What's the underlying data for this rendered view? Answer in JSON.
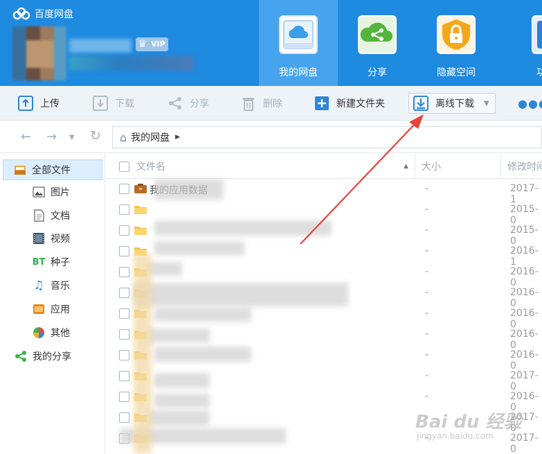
{
  "app": {
    "title": "百度网盘"
  },
  "user": {
    "badge": "VIP"
  },
  "nav_tabs": [
    {
      "label": "我的网盘",
      "icon": "cloud-drive-icon",
      "active": true
    },
    {
      "label": "分享",
      "icon": "share-icon"
    },
    {
      "label": "隐藏空间",
      "icon": "lock-icon"
    },
    {
      "label": "功能宝",
      "icon": "wrench-icon"
    }
  ],
  "toolbar": {
    "upload": "上传",
    "download": "下载",
    "share": "分享",
    "delete": "删除",
    "new_folder": "新建文件夹",
    "offline_download": "离线下载",
    "more": "更"
  },
  "breadcrumb": {
    "root": "我的网盘"
  },
  "sidebar": {
    "items": [
      {
        "label": "全部文件",
        "icon": "folder-tree-icon",
        "selected": true
      },
      {
        "label": "图片",
        "icon": "image-icon"
      },
      {
        "label": "文档",
        "icon": "document-icon"
      },
      {
        "label": "视频",
        "icon": "video-icon"
      },
      {
        "label": "种子",
        "icon": "bt-icon"
      },
      {
        "label": "音乐",
        "icon": "music-icon"
      },
      {
        "label": "应用",
        "icon": "app-icon"
      },
      {
        "label": "其他",
        "icon": "other-icon"
      },
      {
        "label": "我的分享",
        "icon": "share-icon"
      }
    ]
  },
  "file_list": {
    "headers": {
      "name": "文件名",
      "size": "大小",
      "modified": "修改时间"
    },
    "rows": [
      {
        "name": "我的应用数据",
        "size": "-",
        "date": "2017-1"
      },
      {
        "name": "",
        "size": "-",
        "date": "2015-0"
      },
      {
        "name": "",
        "size": "-",
        "date": "2015-0"
      },
      {
        "name": "",
        "size": "-",
        "date": "2016-1"
      },
      {
        "name": "",
        "size": "-",
        "date": "2016-0"
      },
      {
        "name": "",
        "size": "-",
        "date": "2016-0"
      },
      {
        "name": "",
        "size": "-",
        "date": "2016-0"
      },
      {
        "name": "",
        "size": "-",
        "date": "2016-0"
      },
      {
        "name": "",
        "size": "-",
        "date": "2016-0"
      },
      {
        "name": "",
        "size": "-",
        "date": "2017-0"
      },
      {
        "name": "",
        "size": "-",
        "date": "2016-0"
      },
      {
        "name": "",
        "size": "-",
        "date": "2017-0"
      },
      {
        "name": "",
        "size": "-",
        "date": "2017-0"
      }
    ]
  },
  "watermark": {
    "brand": "Bai du 经验",
    "url": "jingyan.baidu.com"
  },
  "colors": {
    "header_bg": "#1e8ae0",
    "active_tab": "#46a3ee",
    "arrow": "#e8423a"
  }
}
